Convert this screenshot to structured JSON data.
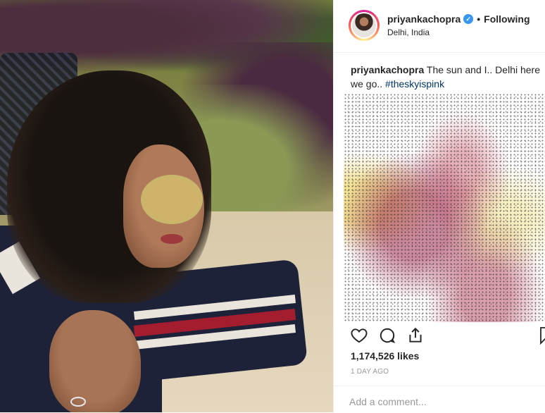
{
  "post": {
    "username": "priyankachopra",
    "verified_icon": "verified-badge-icon",
    "separator": "•",
    "follow_state": "Following",
    "location": "Delhi, India",
    "caption": {
      "username": "priyankachopra",
      "text": " The sun and I.. Delhi here we go.. ",
      "hashtag": "#theskyispink"
    },
    "likes": "1,174,526 likes",
    "time": "1 DAY AGO",
    "comment_placeholder": "Add a comment..."
  },
  "icons": {
    "like": "heart-icon",
    "comment": "comment-bubble-icon",
    "share": "share-icon",
    "save": "bookmark-icon"
  },
  "colors": {
    "verified": "#3897f0",
    "hashtag": "#003569",
    "border": "#efefef",
    "muted": "#999999"
  }
}
